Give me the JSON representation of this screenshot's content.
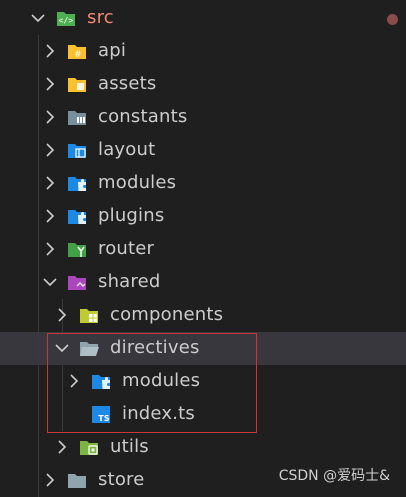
{
  "explorer": {
    "src": {
      "label": "src"
    },
    "items": {
      "api": "api",
      "assets": "assets",
      "constants": "constants",
      "layout": "layout",
      "modules": "modules",
      "plugins": "plugins",
      "router": "router",
      "shared": "shared",
      "components": "components",
      "directives": "directives",
      "directives_modules": "modules",
      "index_ts": "index.ts",
      "utils": "utils",
      "store": "store"
    }
  },
  "colors": {
    "background": "#1f1f1f",
    "selected_row": "#37373d",
    "src_label": "#f48771",
    "highlight_border": "#c43a3a"
  },
  "watermark": "CSDN @爱码士&"
}
